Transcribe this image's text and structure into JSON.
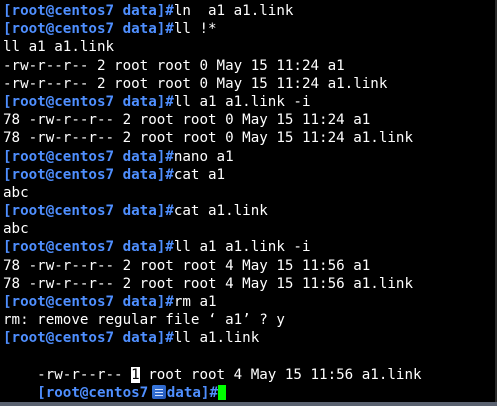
{
  "terminal": {
    "prompt": "[root@centos7 data]#",
    "lines": [
      {
        "type": "cmd",
        "text": "ln  a1 a1.link"
      },
      {
        "type": "cmd",
        "text": "ll !*"
      },
      {
        "type": "out",
        "text": "ll a1 a1.link"
      },
      {
        "type": "out",
        "text": "-rw-r--r-- 2 root root 0 May 15 11:24 a1"
      },
      {
        "type": "out",
        "text": "-rw-r--r-- 2 root root 0 May 15 11:24 a1.link"
      },
      {
        "type": "cmd",
        "text": "ll a1 a1.link -i"
      },
      {
        "type": "out",
        "text": "78 -rw-r--r-- 2 root root 0 May 15 11:24 a1"
      },
      {
        "type": "out",
        "text": "78 -rw-r--r-- 2 root root 0 May 15 11:24 a1.link"
      },
      {
        "type": "cmd",
        "text": "nano a1"
      },
      {
        "type": "cmd",
        "text": "cat a1"
      },
      {
        "type": "out",
        "text": "abc"
      },
      {
        "type": "cmd",
        "text": "cat a1.link"
      },
      {
        "type": "out",
        "text": "abc"
      },
      {
        "type": "cmd",
        "text": "ll a1 a1.link -i"
      },
      {
        "type": "out",
        "text": "78 -rw-r--r-- 2 root root 4 May 15 11:56 a1"
      },
      {
        "type": "out",
        "text": "78 -rw-r--r-- 2 root root 4 May 15 11:56 a1.link"
      },
      {
        "type": "cmd",
        "text": "rm a1"
      },
      {
        "type": "out",
        "text": "rm: remove regular file ‘ a1’ ? y"
      },
      {
        "type": "cmd",
        "text": "ll a1.link"
      }
    ],
    "highlight_line": {
      "before": "-rw-r--r-- ",
      "highlight": "1",
      "after": " root root 4 May 15 11:56 a1.link"
    },
    "final_prompt": {
      "before": "[root@centos7 ",
      "after": "data]#"
    },
    "colors": {
      "background": "#000000",
      "prompt": "#4f8fff",
      "text": "#ffffff",
      "cursor": "#00ff00"
    },
    "icons": {
      "ime": "input-method-icon"
    }
  }
}
